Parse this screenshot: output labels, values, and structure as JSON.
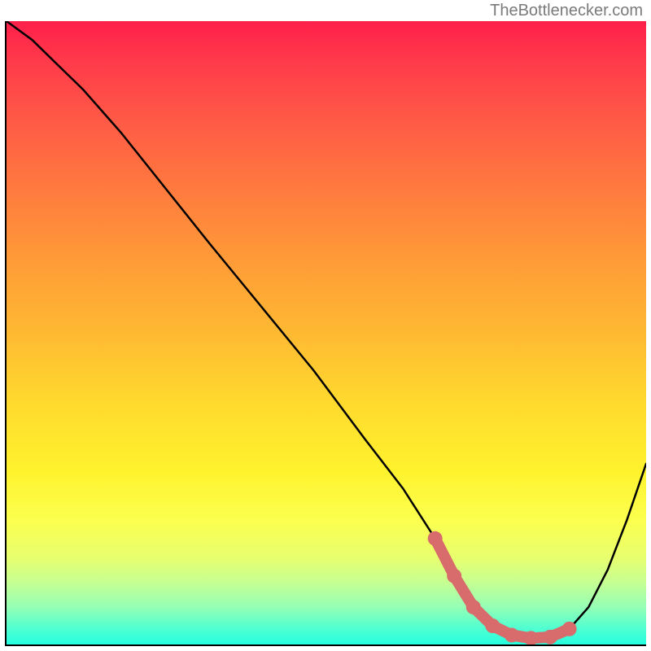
{
  "attribution": "TheBottlenecker.com",
  "chart_data": {
    "type": "line",
    "title": "",
    "xlabel": "",
    "ylabel": "",
    "xlim": [
      0,
      100
    ],
    "ylim": [
      0,
      100
    ],
    "series": [
      {
        "name": "curve",
        "x": [
          0,
          4,
          8,
          12,
          18,
          25,
          32,
          40,
          48,
          56,
          62,
          67,
          70,
          73,
          76,
          79,
          82,
          85,
          88,
          91,
          94,
          97,
          100
        ],
        "y": [
          100,
          97,
          93,
          89,
          82,
          73,
          64,
          54,
          44,
          33,
          25,
          17,
          11,
          6,
          3,
          1.5,
          1,
          1.2,
          2.5,
          6,
          12,
          20,
          29
        ]
      },
      {
        "name": "highlight",
        "x": [
          67,
          70,
          73,
          76,
          79,
          82,
          85,
          88
        ],
        "y": [
          17,
          11,
          6,
          3,
          1.5,
          1,
          1.2,
          2.5
        ]
      }
    ]
  }
}
